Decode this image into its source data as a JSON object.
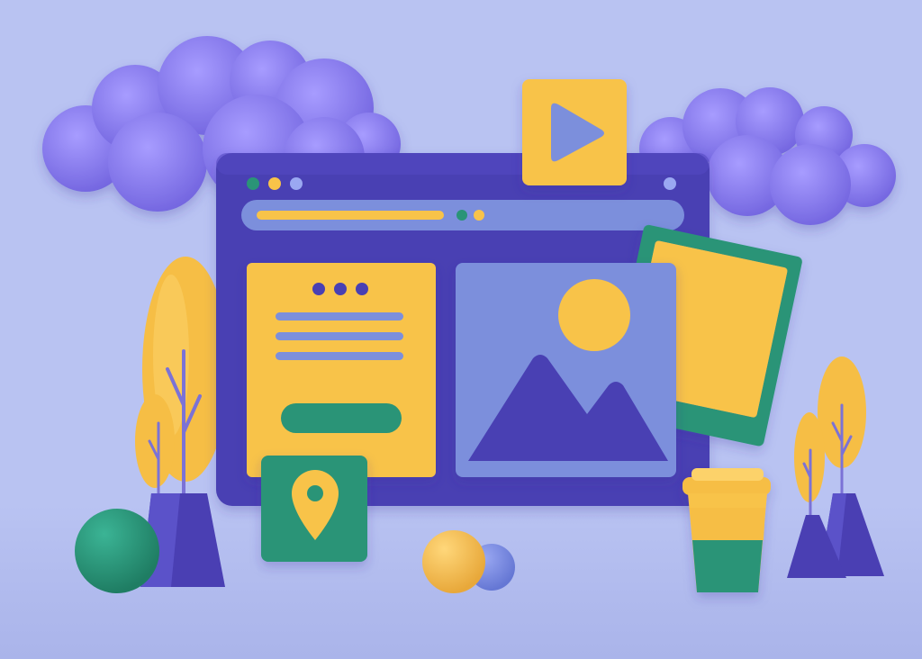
{
  "scene": {
    "description_free": true,
    "colors": {
      "background": "#b9c3f2",
      "floor": "#aeb8ec",
      "purple_dark": "#4a3fb3",
      "purple_mid": "#5b52c9",
      "cloud": "#8c7ff0",
      "cloud_shade": "#7264df",
      "yellow": "#f8c34a",
      "yellow_shade": "#e2a93a",
      "green": "#2a9477",
      "green_dark": "#237c64",
      "blue_soft": "#7b8fdc",
      "bar": "#7b8fdc",
      "stem": "#7b72d6"
    },
    "icons": [
      "cloud-icon",
      "play-icon",
      "browser-window",
      "image-icon",
      "map-pin-icon",
      "coffee-cup-icon",
      "tree-icon",
      "ball-icon"
    ]
  }
}
